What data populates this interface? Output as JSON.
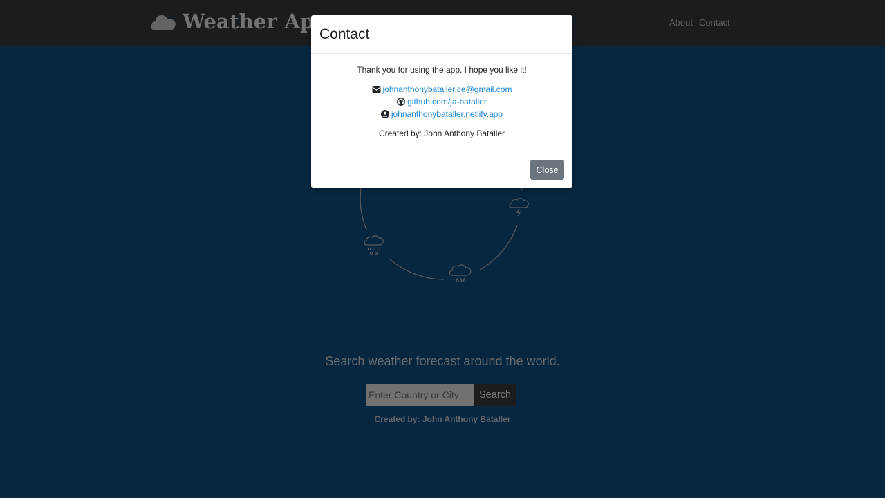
{
  "navbar": {
    "brand_icon": "cloud-icon",
    "brand": "Weather App",
    "links": [
      "About",
      "Contact"
    ]
  },
  "main": {
    "tagline": "Search weather forecast around the world.",
    "search": {
      "placeholder": "Enter Country or City",
      "value": "",
      "button": "Search"
    },
    "credit_label": "Created by:",
    "credit_name": "John Anthony Bataller",
    "circle_icons": [
      "cloud-lightning-icon",
      "cloud-snow-icon",
      "cloud-rain-icon"
    ]
  },
  "modal": {
    "title": "Contact",
    "message": "Thank you for using the app. I hope you like it!",
    "contacts": [
      {
        "icon": "envelope-icon",
        "label": "johnanthonybataller.ce@gmail.com"
      },
      {
        "icon": "github-icon",
        "label": "github.com/ja-bataller"
      },
      {
        "icon": "user-circle-icon",
        "label": "johnanthonybataller.netlify.app"
      }
    ],
    "credit": "Created by: John Anthony Bataller",
    "close": "Close"
  },
  "colors": {
    "background": "#0f4c81",
    "navbar": "#343a40",
    "link": "#1a86d6",
    "close_button": "#6c757d"
  }
}
